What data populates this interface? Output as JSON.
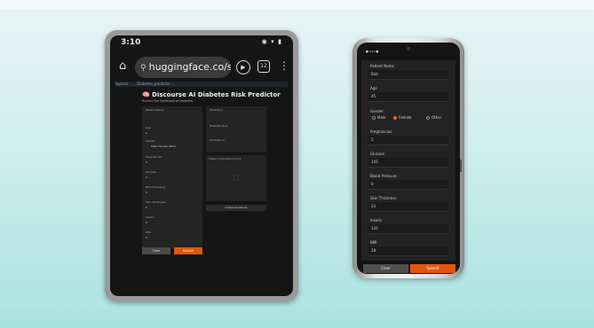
{
  "tablet": {
    "status_time": "3:10",
    "status_right": "◉ ▾ ▮",
    "url": "huggingface.co/spaces/",
    "url_tune_icon": "⚲",
    "tabs_count": "12",
    "breadcrumb": "Spaces ◦ ... Diabetes_predictor ... ",
    "app_title": "🧠 Discourse AI Diabetes Risk Predictor",
    "app_subtitle": "Predict the likelihood of diabetes",
    "form_header": "Patient Name",
    "fields": [
      {
        "label": "Age",
        "value": "0"
      },
      {
        "label": "Gender",
        "value": "Male    Female    Other"
      },
      {
        "label": "Pregnancies",
        "value": "0"
      },
      {
        "label": "Glucose",
        "value": "0"
      },
      {
        "label": "Blood Pressure",
        "value": "0"
      },
      {
        "label": "Skin Thickness",
        "value": "0"
      },
      {
        "label": "Insulin",
        "value": "0"
      },
      {
        "label": "BMI",
        "value": "0"
      }
    ],
    "result_header": "Prediction",
    "result_rows": [
      "Diabetes Risk",
      "Confidence"
    ],
    "plot_label": "Feature Importance Plot",
    "download_label": "Download Result",
    "clear_label": "Clear",
    "submit_label": "Submit"
  },
  "phone": {
    "status_text": "■ 3:10 ■",
    "fields": [
      {
        "label": "Patient Name",
        "value": "Bob"
      },
      {
        "label": "Age",
        "value": "45"
      }
    ],
    "gender_label": "Gender",
    "gender_options": [
      "Male",
      "Female",
      "Other"
    ],
    "gender_selected": "Female",
    "fields2": [
      {
        "label": "Pregnancies",
        "value": "2"
      },
      {
        "label": "Glucose",
        "value": "145"
      },
      {
        "label": "Blood Pressure",
        "value": "0"
      },
      {
        "label": "Skin Thickness",
        "value": "23"
      },
      {
        "label": "Insulin",
        "value": "120"
      },
      {
        "label": "BMI",
        "value": "28"
      }
    ],
    "clear_label": "Clear",
    "submit_label": "Submit"
  }
}
